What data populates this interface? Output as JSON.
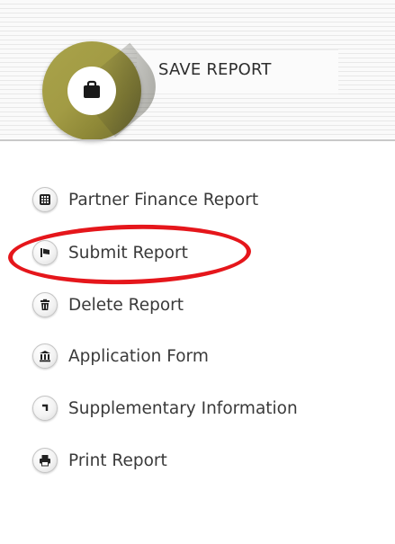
{
  "header": {
    "save_label": "SAVE REPORT"
  },
  "menu": {
    "items": [
      {
        "label": "Partner Finance Report",
        "icon": "calculator-icon"
      },
      {
        "label": "Submit Report",
        "icon": "flag-icon"
      },
      {
        "label": "Delete Report",
        "icon": "trash-icon"
      },
      {
        "label": "Application Form",
        "icon": "building-icon"
      },
      {
        "label": "Supplementary Information",
        "icon": "corner-arrow-icon"
      },
      {
        "label": "Print Report",
        "icon": "print-icon"
      }
    ]
  },
  "colors": {
    "save_circle": "#a29b44",
    "highlight": "#e5161b",
    "text": "#3a3a3a"
  }
}
